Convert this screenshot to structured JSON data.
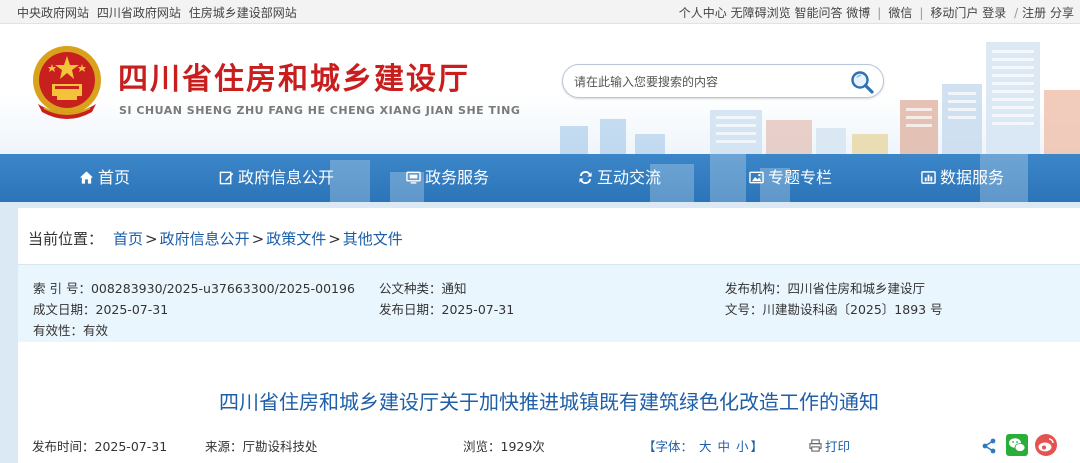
{
  "topbar": {
    "left_links": [
      "中央政府网站",
      "四川省政府网站",
      "住房城乡建设部网站"
    ],
    "right_links": [
      "个人中心",
      "无障碍浏览",
      "智能问答",
      "微博",
      "微信",
      "移动门户",
      "登录",
      "注册",
      "分享"
    ]
  },
  "header": {
    "title": "四川省住房和城乡建设厅",
    "pinyin": "SI CHUAN SHENG ZHU FANG HE CHENG XIANG JIAN SHE TING",
    "search_placeholder": "请在此输入您要搜索的内容"
  },
  "nav": {
    "items": [
      {
        "label": "首页",
        "icon": "home-icon"
      },
      {
        "label": "政府信息公开",
        "icon": "edit-icon"
      },
      {
        "label": "政务服务",
        "icon": "monitor-icon"
      },
      {
        "label": "互动交流",
        "icon": "interaction-icon"
      },
      {
        "label": "专题专栏",
        "icon": "image-icon"
      },
      {
        "label": "数据服务",
        "icon": "chart-icon"
      }
    ]
  },
  "breadcrumb": {
    "label": "当前位置：",
    "items": [
      "首页",
      "政府信息公开",
      "政策文件",
      "其他文件"
    ]
  },
  "meta": {
    "index_no": "索 引 号：008283930/2025-u37663300/2025-00196",
    "doc_type": "公文种类：通知",
    "publisher": "发布机构：四川省住房和城乡建设厅",
    "written_date": "成文日期：2025-07-31",
    "publish_date": "发布日期：2025-07-31",
    "doc_number": "文号：川建勘设科函〔2025〕1893 号",
    "validity": "有效性：有效"
  },
  "document": {
    "title": "四川省住房和城乡建设厅关于加快推进城镇既有建筑绿色化改造工作的通知",
    "publish_time": "发布时间：2025-07-31",
    "source": "来源：厅勘设科技处",
    "views": "浏览：1929次",
    "font_label": "【字体：",
    "font_sizes": [
      "大",
      "中",
      "小"
    ],
    "font_close": "】",
    "print_label": "打印"
  },
  "colors": {
    "accent_red": "#c81e1e",
    "nav_blue": "#2f7bc0",
    "link_blue": "#1a5ea8",
    "meta_bg": "#eaf6fd"
  }
}
